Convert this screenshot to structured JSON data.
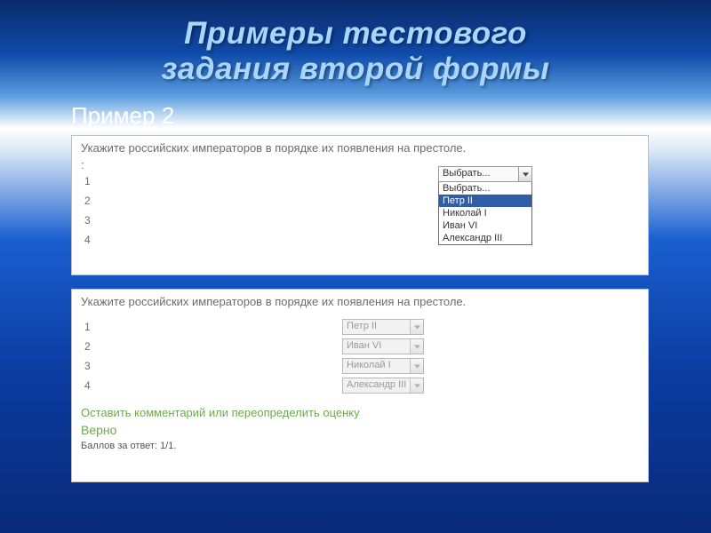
{
  "title_line1": "Примеры тестового",
  "title_line2": "задания второй формы",
  "subtitle": "Пример 2",
  "panel1": {
    "question": "Укажите российских императоров в порядке их появления на престоле.",
    "colon": ":",
    "rows": [
      "1",
      "2",
      "3",
      "4"
    ],
    "dropdown": {
      "closed_label": "Выбрать...",
      "options": [
        "Выбрать...",
        "Петр II",
        "Николай I",
        "Иван VI",
        "Александр III"
      ],
      "selected_index": 1
    }
  },
  "panel2": {
    "question": "Укажите российских императоров в порядке их появления на престоле.",
    "rows": [
      {
        "num": "1",
        "value": "Петр II"
      },
      {
        "num": "2",
        "value": "Иван VI"
      },
      {
        "num": "3",
        "value": "Николай I"
      },
      {
        "num": "4",
        "value": "Александр III"
      }
    ],
    "comment_link": "Оставить комментарий или переопределить оценку",
    "result": "Верно",
    "score": "Баллов за ответ: 1/1."
  }
}
